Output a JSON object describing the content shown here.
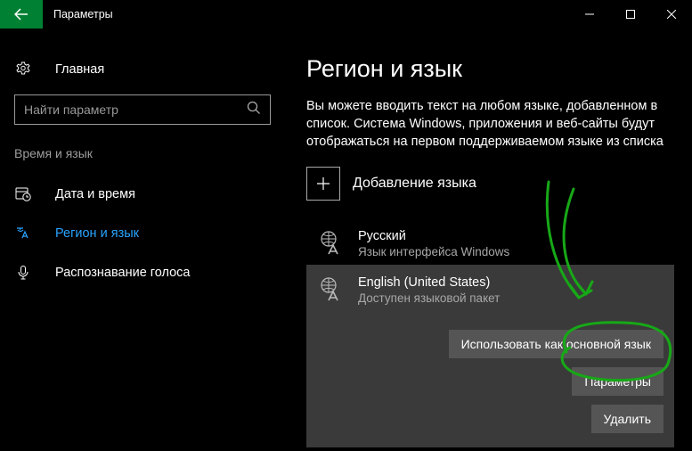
{
  "titlebar": {
    "app_title": "Параметры"
  },
  "sidebar": {
    "home_label": "Главная",
    "search_placeholder": "Найти параметр",
    "category_heading": "Время и язык",
    "items": [
      {
        "label": "Дата и время"
      },
      {
        "label": "Регион и язык"
      },
      {
        "label": "Распознавание голоса"
      }
    ]
  },
  "main": {
    "page_title": "Регион и язык",
    "description": "Вы можете вводить текст на любом языке, добавленном в список. Система Windows, приложения и веб-сайты будут отображаться на первом поддерживаемом языке из списка",
    "add_language_label": "Добавление языка",
    "languages": [
      {
        "name": "Русский",
        "sub": "Язык интерфейса Windows"
      },
      {
        "name": "English (United States)",
        "sub": "Доступен языковой пакет"
      }
    ],
    "buttons": {
      "set_default": "Использовать как основной язык",
      "options": "Параметры",
      "remove": "Удалить"
    }
  },
  "annotation_color": "#17a817"
}
